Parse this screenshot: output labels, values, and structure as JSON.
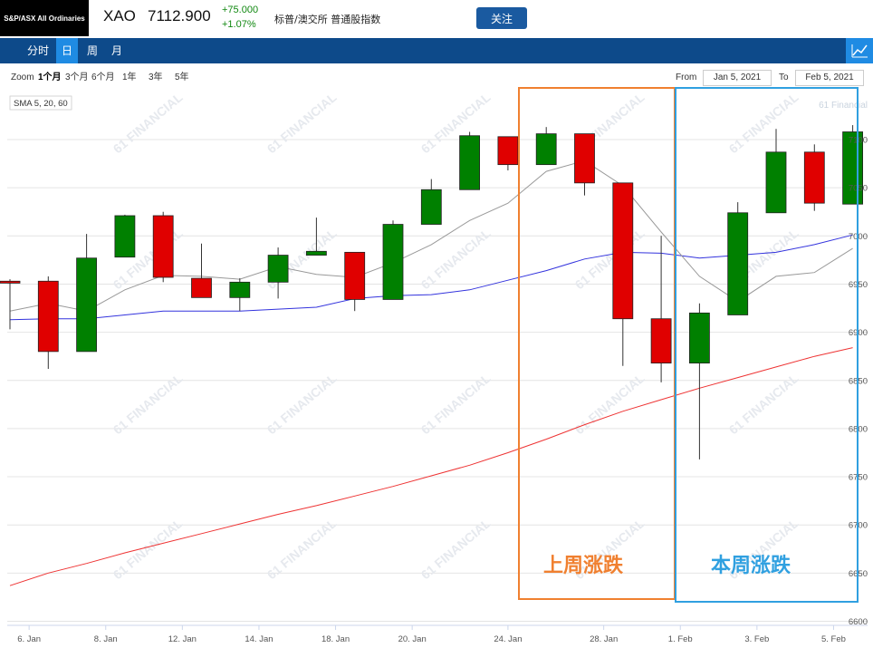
{
  "header": {
    "logo": "S&P/ASX All Ordinaries",
    "symbol": "XAO",
    "price": "7112.900",
    "change": "+75.000",
    "change_pct": "+1.07%",
    "exchange": "标普/澳交所 普通股指数",
    "follow_label": "关注"
  },
  "nav": {
    "tabs": [
      "分时",
      "日",
      "周",
      "月"
    ],
    "active": "日"
  },
  "zoom": {
    "label": "Zoom",
    "options": [
      "1个月",
      "3个月",
      "6个月",
      "1年",
      "3年",
      "5年"
    ],
    "selected": "1个月"
  },
  "range": {
    "from_label": "From",
    "from": "Jan 5, 2021",
    "to_label": "To",
    "to": "Feb 5, 2021"
  },
  "indicator_label": "SMA 5, 20, 60",
  "watermark": "61 FINANCIAL",
  "watermark_corner": "61 Financial",
  "colors": {
    "up": "#008000",
    "down": "#e00000",
    "sma5": "#999999",
    "sma20": "#3333dd",
    "sma60": "#ee3333",
    "last_week_box": "#f08030",
    "this_week_box": "#30a0e0"
  },
  "chart_data": {
    "type": "candlestick",
    "y_ticks": [
      6600,
      6650,
      6700,
      6750,
      6800,
      6850,
      6900,
      6950,
      7000,
      7050,
      7100
    ],
    "y_tick_labels": [
      "6600",
      "6650",
      "6700",
      "6750",
      "6800",
      "6850",
      "6900",
      "6950",
      "7000",
      "7050",
      "7100"
    ],
    "ylim": [
      6595,
      7120
    ],
    "x_labels": [
      "6. Jan",
      "8. Jan",
      "12. Jan",
      "14. Jan",
      "18. Jan",
      "20. Jan",
      "24. Jan",
      "28. Jan",
      "1. Feb",
      "3. Feb",
      "5. Feb"
    ],
    "x_label_positions": [
      0.5,
      2.5,
      4.5,
      6.5,
      8.5,
      10.5,
      13,
      15.5,
      17.5,
      19.5,
      21.5
    ],
    "ohlc": [
      {
        "o": 6953,
        "h": 6955,
        "l": 6903,
        "c": 6951
      },
      {
        "o": 6953,
        "h": 6958,
        "l": 6862,
        "c": 6880
      },
      {
        "o": 6880,
        "h": 7002,
        "l": 6880,
        "c": 6977
      },
      {
        "o": 6978,
        "h": 7022,
        "l": 6978,
        "c": 7021
      },
      {
        "o": 7021,
        "h": 7025,
        "l": 6952,
        "c": 6957
      },
      {
        "o": 6956,
        "h": 6992,
        "l": 6936,
        "c": 6936
      },
      {
        "o": 6936,
        "h": 6956,
        "l": 6922,
        "c": 6952
      },
      {
        "o": 6952,
        "h": 6988,
        "l": 6935,
        "c": 6980
      },
      {
        "o": 6980,
        "h": 7019,
        "l": 6980,
        "c": 6984
      },
      {
        "o": 6983,
        "h": 6983,
        "l": 6922,
        "c": 6934
      },
      {
        "o": 6934,
        "h": 7016,
        "l": 6934,
        "c": 7012
      },
      {
        "o": 7012,
        "h": 7059,
        "l": 7012,
        "c": 7048
      },
      {
        "o": 7048,
        "h": 7108,
        "l": 7048,
        "c": 7104
      },
      {
        "o": 7103,
        "h": 7103,
        "l": 7068,
        "c": 7074
      },
      {
        "o": 7074,
        "h": 7113,
        "l": 7074,
        "c": 7106
      },
      {
        "o": 7106,
        "h": 7106,
        "l": 7042,
        "c": 7055
      },
      {
        "o": 7055,
        "h": 7055,
        "l": 6865,
        "c": 6914
      },
      {
        "o": 6914,
        "h": 7000,
        "l": 6848,
        "c": 6868
      },
      {
        "o": 6868,
        "h": 6930,
        "l": 6768,
        "c": 6920
      },
      {
        "o": 6918,
        "h": 7035,
        "l": 6918,
        "c": 7024
      },
      {
        "o": 7024,
        "h": 7111,
        "l": 7024,
        "c": 7087
      },
      {
        "o": 7087,
        "h": 7095,
        "l": 7026,
        "c": 7034
      },
      {
        "o": 7033,
        "h": 7115,
        "l": 7033,
        "c": 7108
      }
    ],
    "sma5": [
      6922,
      6930,
      6922,
      6944,
      6959,
      6958,
      6955,
      6968,
      6960,
      6957,
      6972,
      6991,
      7016,
      7034,
      7067,
      7078,
      7052,
      7004,
      6958,
      6932,
      6958,
      6962,
      6987
    ],
    "sma20": [
      6913,
      6914,
      6914,
      6918,
      6922,
      6922,
      6922,
      6924,
      6926,
      6935,
      6938,
      6939,
      6944,
      6954,
      6964,
      6976,
      6983,
      6982,
      6977,
      6980,
      6983,
      6991,
      7001
    ],
    "sma60": [
      6637,
      6650,
      6660,
      6671,
      6681,
      6691,
      6701,
      6711,
      6720,
      6730,
      6740,
      6751,
      6762,
      6775,
      6789,
      6804,
      6818,
      6830,
      6842,
      6853,
      6864,
      6875,
      6884
    ]
  },
  "annotations": {
    "last_week": "上周涨跌",
    "this_week": "本周涨跌"
  }
}
